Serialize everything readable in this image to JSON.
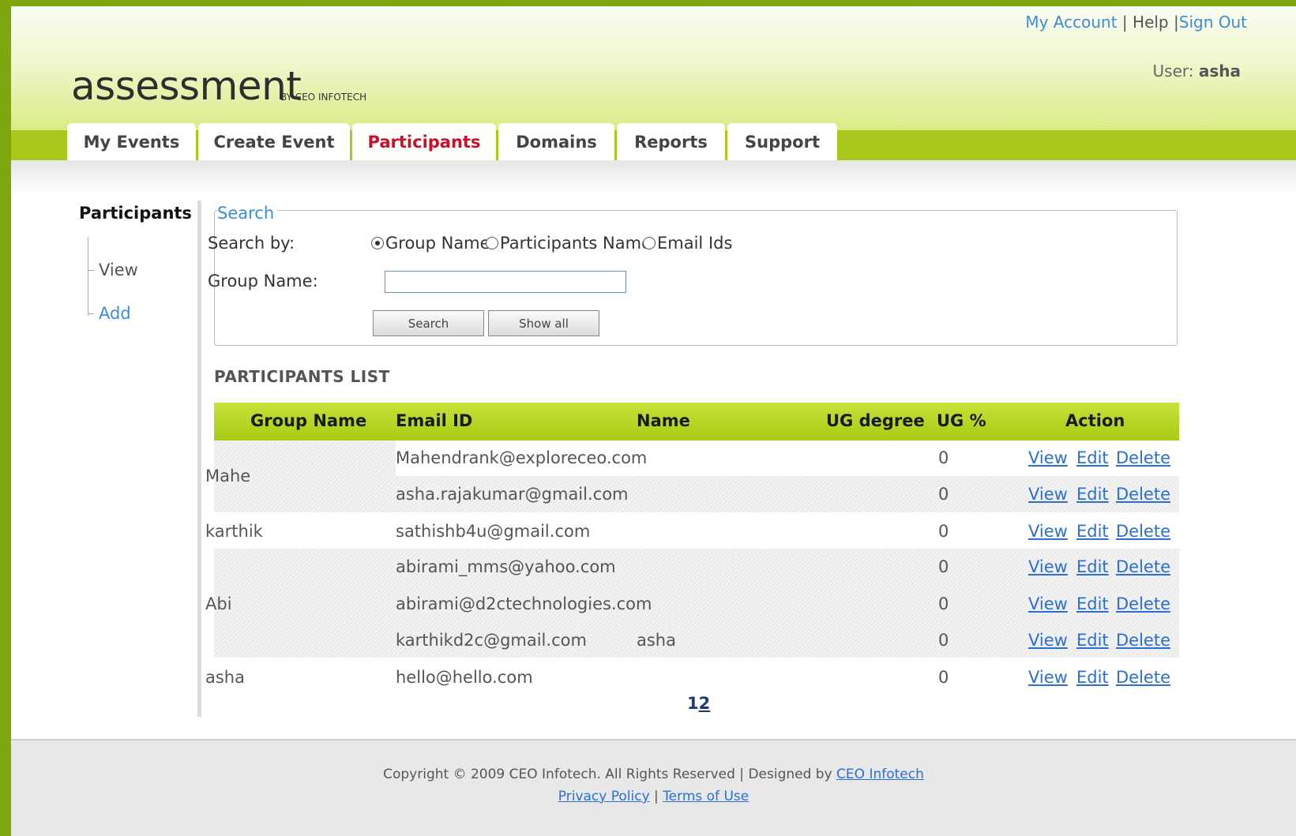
{
  "header": {
    "my_account": "My Account",
    "help": "Help",
    "sign_out": "Sign Out",
    "user_label": "User:",
    "user_name": "asha",
    "logo": "assessment",
    "logo_sub": "BY CEO INFOTECH"
  },
  "tabs": [
    {
      "label": "My Events",
      "active": false
    },
    {
      "label": "Create Event",
      "active": false
    },
    {
      "label": "Participants",
      "active": true
    },
    {
      "label": "Domains",
      "active": false
    },
    {
      "label": "Reports",
      "active": false
    },
    {
      "label": "Support",
      "active": false
    }
  ],
  "sidebar": {
    "title": "Participants",
    "items": [
      {
        "label": "View"
      },
      {
        "label": "Add"
      }
    ]
  },
  "search": {
    "legend": "Search",
    "search_by_label": "Search by:",
    "options": [
      {
        "label": "Group Name",
        "selected": true
      },
      {
        "label": "Participants Name",
        "selected": false
      },
      {
        "label": "Email Ids",
        "selected": false
      }
    ],
    "group_name_label": "Group Name:",
    "group_name_value": "",
    "search_button": "Search",
    "show_all_button": "Show all"
  },
  "list": {
    "title": "PARTICIPANTS LIST",
    "columns": [
      "Group Name",
      "Email ID",
      "Name",
      "UG degree",
      "UG %",
      "Action"
    ],
    "groups": [
      {
        "group": "Mahe",
        "rows": [
          {
            "email": "Mahendrank@exploreceo.com",
            "name": "",
            "ug_degree": "",
            "ug_pct": "0"
          },
          {
            "email": "asha.rajakumar@gmail.com",
            "name": "",
            "ug_degree": "",
            "ug_pct": "0"
          }
        ]
      },
      {
        "group": "karthik",
        "rows": [
          {
            "email": "sathishb4u@gmail.com",
            "name": "",
            "ug_degree": "",
            "ug_pct": "0"
          }
        ]
      },
      {
        "group": "Abi",
        "rows": [
          {
            "email": "abirami_mms@yahoo.com",
            "name": "",
            "ug_degree": "",
            "ug_pct": "0"
          },
          {
            "email": "abirami@d2ctechnologies.com",
            "name": "",
            "ug_degree": "",
            "ug_pct": "0"
          },
          {
            "email": "karthikd2c@gmail.com",
            "name": "asha",
            "ug_degree": "",
            "ug_pct": "0"
          }
        ]
      },
      {
        "group": "asha",
        "rows": [
          {
            "email": "hello@hello.com",
            "name": "",
            "ug_degree": "",
            "ug_pct": "0"
          }
        ]
      }
    ],
    "actions": {
      "view": "View",
      "edit": "Edit",
      "delete": "Delete"
    },
    "pages": [
      "1",
      "2"
    ]
  },
  "footer": {
    "copyright": "Copyright © 2009 CEO Infotech. All Rights Reserved | Designed by",
    "designer": "CEO Infotech",
    "privacy": "Privacy Policy",
    "separator": "|",
    "terms": "Terms of Use"
  },
  "colors": {
    "brand_green": "#a8c81c",
    "active_tab": "#c8102e",
    "link": "#2a6fd8"
  }
}
